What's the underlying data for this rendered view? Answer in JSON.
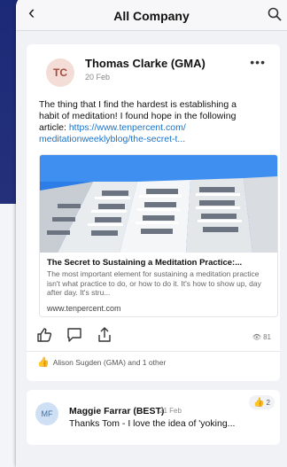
{
  "header": {
    "title": "All Company"
  },
  "post": {
    "avatar_initials": "TC",
    "author": "Thomas Clarke (GMA)",
    "date": "20 Feb",
    "text_line1": "The thing that I find the hardest is establishing a",
    "text_line2": "habit of meditation! I found hope in the following",
    "text_line3_prefix": "article: ",
    "link_line1": "https://www.tenpercent.com/",
    "link_line2": "meditationweeklyblog/the-secret-t...",
    "link_preview": {
      "title": "The Secret to Sustaining a Meditation Practice:...",
      "description": "The most important element for sustaining a meditation practice isn't what practice to do, or how to do it. It's how to show up, day after day. It's stru...",
      "domain": "www.tenpercent.com"
    },
    "views": "81",
    "reactors": "Alison Sugden (GMA) and 1 other"
  },
  "comment": {
    "avatar_initials": "MF",
    "author": "Maggie Farrar (BEST)",
    "date": "21 Feb",
    "text": "Thanks Tom - I love the idea of 'yoking...",
    "reaction_count": "2"
  },
  "colors": {
    "accent": "#1a73c8",
    "background": "#1e2a6b"
  },
  "icons": [
    "back-chevron-icon",
    "search-icon",
    "more-icon",
    "like-icon",
    "comment-icon",
    "share-icon",
    "eye-icon",
    "thumbs-up-icon"
  ]
}
